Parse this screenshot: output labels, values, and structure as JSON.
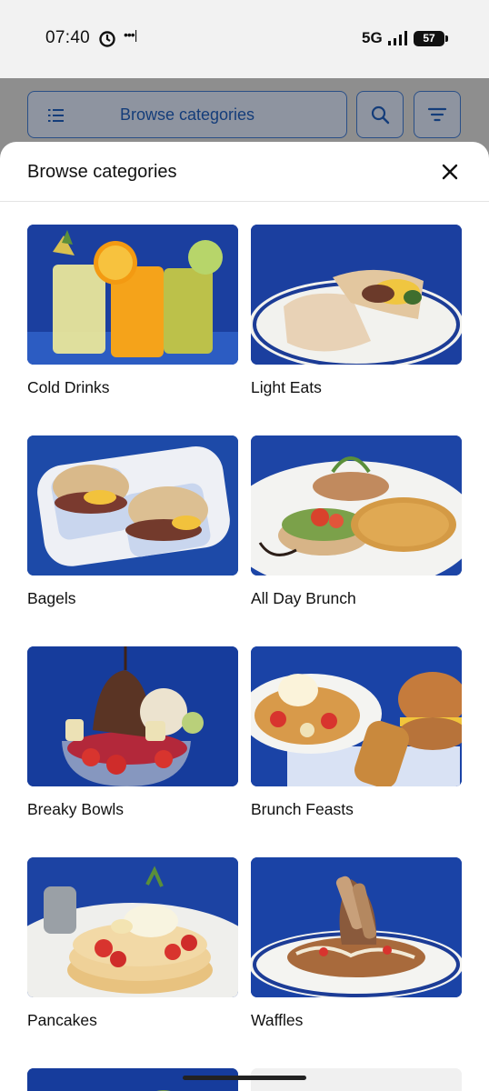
{
  "status_bar": {
    "time": "07:40",
    "network": "5G",
    "battery": "57",
    "icons": [
      "sync-icon",
      "more-dots-icon",
      "signal-icon",
      "battery-icon"
    ]
  },
  "background_toolbar": {
    "browse_label": "Browse categories",
    "icons": [
      "list-icon",
      "search-icon",
      "filter-icon"
    ]
  },
  "sheet": {
    "title": "Browse categories",
    "close_icon": "close-icon",
    "categories": [
      {
        "label": "Cold Drinks"
      },
      {
        "label": "Light Eats"
      },
      {
        "label": "Bagels"
      },
      {
        "label": "All Day Brunch"
      },
      {
        "label": "Breaky Bowls"
      },
      {
        "label": "Brunch Feasts"
      },
      {
        "label": "Pancakes"
      },
      {
        "label": "Waffles"
      },
      {
        "label": ""
      },
      {
        "label": ""
      }
    ]
  },
  "colors": {
    "brand_blue": "#143d7a",
    "photo_blue": "#1a3f9e",
    "text": "#111111"
  }
}
